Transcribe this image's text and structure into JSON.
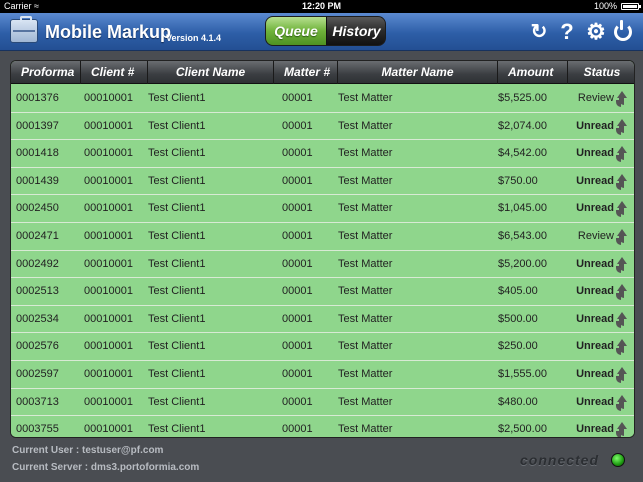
{
  "status_bar": {
    "carrier": "Carrier",
    "wifi_icon": "wifi-icon",
    "time": "12:20 PM",
    "battery_percent": "100%"
  },
  "header": {
    "app_icon": "briefcase-icon",
    "title": "Mobile Markup",
    "version": "Version 4.1.4",
    "tabs": [
      {
        "label": "Queue",
        "selected": true
      },
      {
        "label": "History",
        "selected": false
      }
    ],
    "toolbar_icons": [
      "refresh-icon",
      "help-icon",
      "settings-icon",
      "power-icon"
    ]
  },
  "table": {
    "columns": [
      {
        "key": "proforma",
        "label": "Proforma",
        "sorted": "ascending"
      },
      {
        "key": "client_no",
        "label": "Client #"
      },
      {
        "key": "client_name",
        "label": "Client Name"
      },
      {
        "key": "matter_no",
        "label": "Matter #"
      },
      {
        "key": "matter_name",
        "label": "Matter Name"
      },
      {
        "key": "amount",
        "label": "Amount"
      },
      {
        "key": "status",
        "label": "Status"
      }
    ],
    "rows": [
      {
        "proforma": "0001376",
        "client_no": "00010001",
        "client_name": "Test Client1",
        "matter_no": "00001",
        "matter_name": "Test Matter",
        "amount": "$5,525.00",
        "status": "Review"
      },
      {
        "proforma": "0001397",
        "client_no": "00010001",
        "client_name": "Test Client1",
        "matter_no": "00001",
        "matter_name": "Test Matter",
        "amount": "$2,074.00",
        "status": "Unread"
      },
      {
        "proforma": "0001418",
        "client_no": "00010001",
        "client_name": "Test Client1",
        "matter_no": "00001",
        "matter_name": "Test Matter",
        "amount": "$4,542.00",
        "status": "Unread"
      },
      {
        "proforma": "0001439",
        "client_no": "00010001",
        "client_name": "Test Client1",
        "matter_no": "00001",
        "matter_name": "Test Matter",
        "amount": "$750.00",
        "status": "Unread"
      },
      {
        "proforma": "0002450",
        "client_no": "00010001",
        "client_name": "Test Client1",
        "matter_no": "00001",
        "matter_name": "Test Matter",
        "amount": "$1,045.00",
        "status": "Unread"
      },
      {
        "proforma": "0002471",
        "client_no": "00010001",
        "client_name": "Test Client1",
        "matter_no": "00001",
        "matter_name": "Test Matter",
        "amount": "$6,543.00",
        "status": "Review"
      },
      {
        "proforma": "0002492",
        "client_no": "00010001",
        "client_name": "Test Client1",
        "matter_no": "00001",
        "matter_name": "Test Matter",
        "amount": "$5,200.00",
        "status": "Unread"
      },
      {
        "proforma": "0002513",
        "client_no": "00010001",
        "client_name": "Test Client1",
        "matter_no": "00001",
        "matter_name": "Test Matter",
        "amount": "$405.00",
        "status": "Unread"
      },
      {
        "proforma": "0002534",
        "client_no": "00010001",
        "client_name": "Test Client1",
        "matter_no": "00001",
        "matter_name": "Test Matter",
        "amount": "$500.00",
        "status": "Unread"
      },
      {
        "proforma": "0002576",
        "client_no": "00010001",
        "client_name": "Test Client1",
        "matter_no": "00001",
        "matter_name": "Test Matter",
        "amount": "$250.00",
        "status": "Unread"
      },
      {
        "proforma": "0002597",
        "client_no": "00010001",
        "client_name": "Test Client1",
        "matter_no": "00001",
        "matter_name": "Test Matter",
        "amount": "$1,555.00",
        "status": "Unread"
      },
      {
        "proforma": "0003713",
        "client_no": "00010001",
        "client_name": "Test Client1",
        "matter_no": "00001",
        "matter_name": "Test Matter",
        "amount": "$480.00",
        "status": "Unread"
      },
      {
        "proforma": "0003755",
        "client_no": "00010001",
        "client_name": "Test Client1",
        "matter_no": "00001",
        "matter_name": "Test Matter",
        "amount": "$2,500.00",
        "status": "Unread"
      }
    ],
    "status_icon": "share-arrow-icon"
  },
  "footer": {
    "current_user": "Current User : testuser@pf.com",
    "current_server": "Current Server : dms3.portoformia.com",
    "connection_status": "connected",
    "connection_icon": "connection-led-icon"
  },
  "colors": {
    "header_blue": "#2d5ea7",
    "row_green": "#8fd68c",
    "queue_tab_green": "#6fb23a",
    "background": "#4a4d52"
  }
}
